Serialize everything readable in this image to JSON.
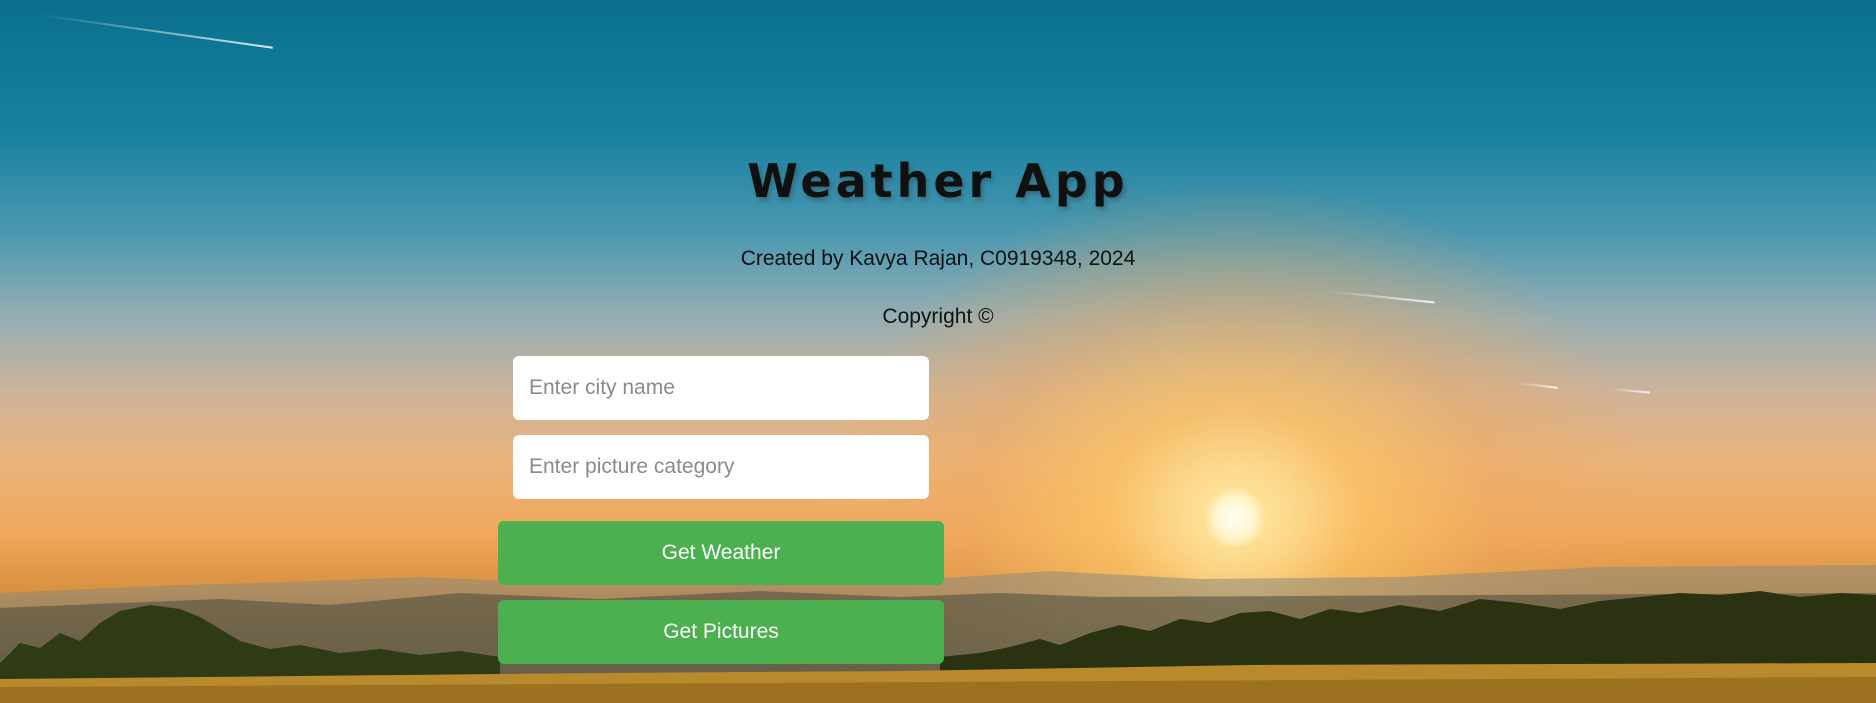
{
  "app": {
    "title": "Weather App",
    "credit": "Created by Kavya Rajan, C0919348, 2024",
    "copyright": "Copyright ©"
  },
  "form": {
    "city_placeholder": "Enter city name",
    "city_value": "",
    "category_placeholder": "Enter picture category",
    "category_value": ""
  },
  "buttons": {
    "weather_label": "Get Weather",
    "pictures_label": "Get Pictures"
  },
  "colors": {
    "button_bg": "#4caf50",
    "button_text": "#ffffff",
    "title_text": "#0f1010"
  }
}
